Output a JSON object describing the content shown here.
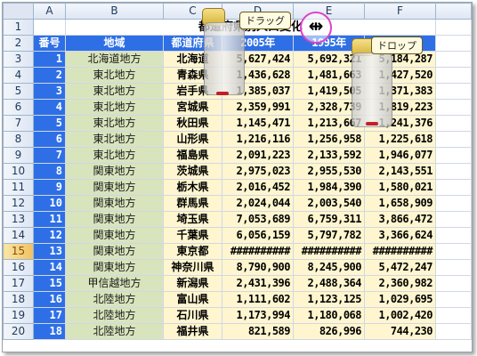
{
  "columns": [
    "A",
    "B",
    "C",
    "D",
    "E",
    "F"
  ],
  "title": "都道府県別人口変化",
  "header": {
    "no": "番号",
    "region": "地域",
    "pref": "都道府県",
    "y2005": "2005年",
    "y1995": "1995年",
    "y1970": "1970年"
  },
  "rows": [
    {
      "row": 3,
      "no": 1,
      "region": "北海道地方",
      "pref": "北海道",
      "y2005": "5,627,424",
      "y1995": "5,692,321",
      "y1970": "5,184,287"
    },
    {
      "row": 4,
      "no": 2,
      "region": "東北地方",
      "pref": "青森県",
      "y2005": "1,436,628",
      "y1995": "1,481,663",
      "y1970": "1,427,520"
    },
    {
      "row": 5,
      "no": 3,
      "region": "東北地方",
      "pref": "岩手県",
      "y2005": "1,385,037",
      "y1995": "1,419,505",
      "y1970": "1,371,383"
    },
    {
      "row": 6,
      "no": 4,
      "region": "東北地方",
      "pref": "宮城県",
      "y2005": "2,359,991",
      "y1995": "2,328,739",
      "y1970": "1,819,223"
    },
    {
      "row": 7,
      "no": 5,
      "region": "東北地方",
      "pref": "秋田県",
      "y2005": "1,145,471",
      "y1995": "1,213,667",
      "y1970": "1,241,376"
    },
    {
      "row": 8,
      "no": 6,
      "region": "東北地方",
      "pref": "山形県",
      "y2005": "1,216,116",
      "y1995": "1,256,958",
      "y1970": "1,225,618"
    },
    {
      "row": 9,
      "no": 7,
      "region": "東北地方",
      "pref": "福島県",
      "y2005": "2,091,223",
      "y1995": "2,133,592",
      "y1970": "1,946,077"
    },
    {
      "row": 10,
      "no": 8,
      "region": "関東地方",
      "pref": "茨城県",
      "y2005": "2,975,023",
      "y1995": "2,955,530",
      "y1970": "2,143,551"
    },
    {
      "row": 11,
      "no": 9,
      "region": "関東地方",
      "pref": "栃木県",
      "y2005": "2,016,452",
      "y1995": "1,984,390",
      "y1970": "1,580,021"
    },
    {
      "row": 12,
      "no": 10,
      "region": "関東地方",
      "pref": "群馬県",
      "y2005": "2,024,044",
      "y1995": "2,003,540",
      "y1970": "1,658,909"
    },
    {
      "row": 13,
      "no": 11,
      "region": "関東地方",
      "pref": "埼玉県",
      "y2005": "7,053,689",
      "y1995": "6,759,311",
      "y1970": "3,866,472"
    },
    {
      "row": 14,
      "no": 12,
      "region": "関東地方",
      "pref": "千葉県",
      "y2005": "6,056,159",
      "y1995": "5,797,782",
      "y1970": "3,366,624"
    },
    {
      "row": 15,
      "no": 13,
      "region": "関東地方",
      "pref": "東京都",
      "y2005": "##########",
      "y1995": "##########",
      "y1970": "##########"
    },
    {
      "row": 16,
      "no": 14,
      "region": "関東地方",
      "pref": "神奈川県",
      "y2005": "8,790,900",
      "y1995": "8,245,900",
      "y1970": "5,472,247"
    },
    {
      "row": 17,
      "no": 15,
      "region": "甲信越地方",
      "pref": "新潟県",
      "y2005": "2,431,396",
      "y1995": "2,488,364",
      "y1970": "2,360,982"
    },
    {
      "row": 18,
      "no": 16,
      "region": "北陸地方",
      "pref": "富山県",
      "y2005": "1,111,602",
      "y1995": "1,123,125",
      "y1970": "1,029,695"
    },
    {
      "row": 19,
      "no": 17,
      "region": "北陸地方",
      "pref": "石川県",
      "y2005": "1,173,994",
      "y1995": "1,180,068",
      "y1970": "1,002,420"
    },
    {
      "row": 20,
      "no": 18,
      "region": "北陸地方",
      "pref": "福井県",
      "y2005": "821,589",
      "y1995": "826,996",
      "y1970": "744,230"
    }
  ],
  "callouts": {
    "drag": "ドラッグ",
    "drop": "ドロップ"
  },
  "cursor": {
    "icon": "resize-column-icon",
    "glyph": "⇹"
  },
  "colors": {
    "number_fill": "#2e6fe6",
    "region_fill": "#d8e4bc",
    "value_fill": "#fff6cf",
    "highlight_ring": "#e040c8"
  }
}
